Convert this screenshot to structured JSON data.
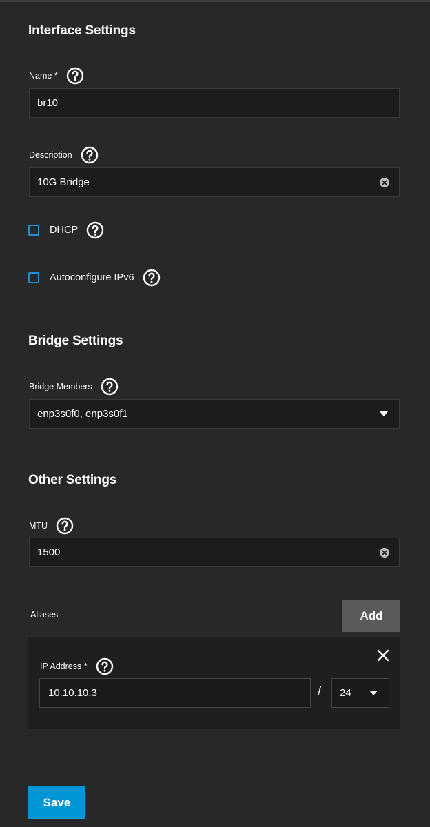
{
  "interface_settings": {
    "title": "Interface Settings",
    "name": {
      "label": "Name",
      "required_mark": "*",
      "value": "br10"
    },
    "description": {
      "label": "Description",
      "value": "10G Bridge"
    },
    "dhcp": {
      "label": "DHCP",
      "checked": false
    },
    "autoconfigure_ipv6": {
      "label": "Autoconfigure IPv6",
      "checked": false
    }
  },
  "bridge_settings": {
    "title": "Bridge Settings",
    "bridge_members": {
      "label": "Bridge Members",
      "value": "enp3s0f0, enp3s0f1"
    }
  },
  "other_settings": {
    "title": "Other Settings",
    "mtu": {
      "label": "MTU",
      "value": "1500"
    }
  },
  "aliases": {
    "label": "Aliases",
    "add_label": "Add",
    "items": [
      {
        "ip_label": "IP Address",
        "required_mark": "*",
        "ip_value": "10.10.10.3",
        "separator": "/",
        "netmask": "24"
      }
    ]
  },
  "save_label": "Save",
  "icons": {
    "help": "help-circle-icon",
    "clear": "clear-circle-icon",
    "dropdown": "caret-down-icon",
    "remove": "close-icon"
  },
  "colors": {
    "background": "#282828",
    "input_background": "#1c1c1c",
    "accent": "#0095d5",
    "checkbox_border": "#1c8fd6",
    "add_button": "#5a5a5a"
  }
}
